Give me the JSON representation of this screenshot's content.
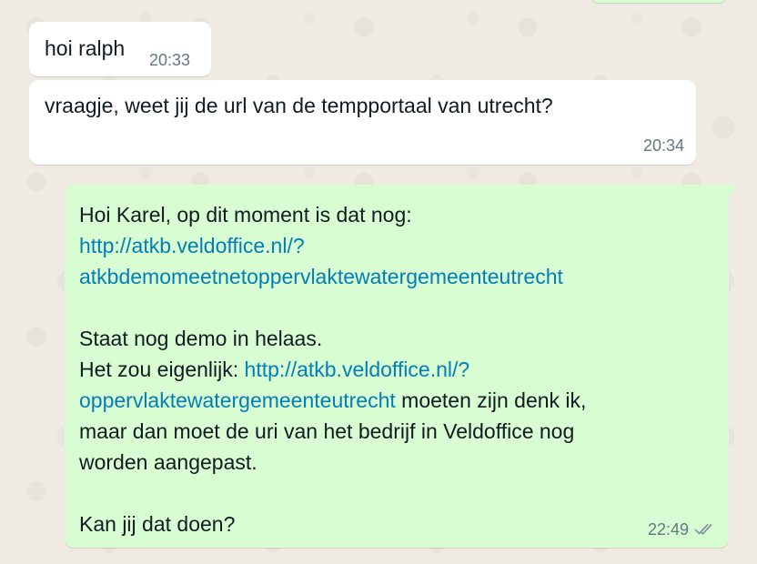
{
  "messages": [
    {
      "direction": "incoming",
      "text": "hoi ralph",
      "time": "20:33"
    },
    {
      "direction": "incoming",
      "text": "vraagje, weet jij de url van de tempportaal van utrecht?",
      "time": "20:34"
    },
    {
      "direction": "outgoing",
      "time": "22:49",
      "status_icon": "double-check-icon",
      "lines": {
        "l1": "Hoi Karel, op dit moment is dat nog:",
        "l2_link": "http://atkb.veldoffice.nl/?",
        "l3_link": "atkbdemomeetnetoppervlaktewatergemeenteutrecht",
        "l4": "Staat nog demo in helaas.",
        "l5_text": "Het zou eigenlijk: ",
        "l5_link": "http://atkb.veldoffice.nl/?",
        "l6_link": "oppervlaktewatergemeenteutrecht",
        "l6_text": " moeten zijn denk ik,",
        "l7": "maar dan moet de uri van het bedrijf in Veldoffice nog",
        "l8": "worden aangepast.",
        "l9": "Kan jij dat doen?"
      }
    }
  ],
  "colors": {
    "background": "#efeae2",
    "incoming_bubble": "#ffffff",
    "outgoing_bubble": "#d9fdd3",
    "link": "#027eb5",
    "meta_text": "#667781"
  }
}
